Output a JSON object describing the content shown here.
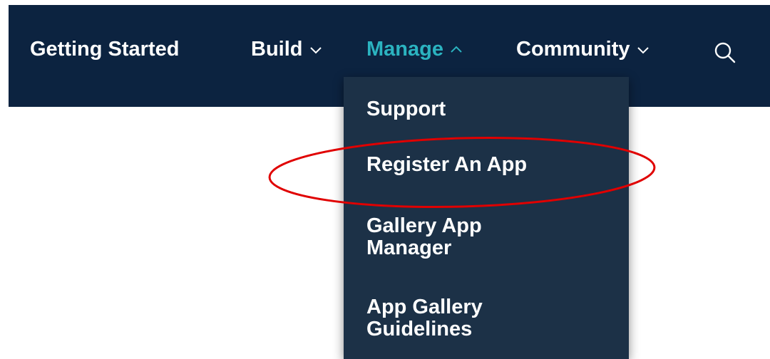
{
  "nav": {
    "items": [
      {
        "label": "Getting Started",
        "has_chevron": false,
        "active": false
      },
      {
        "label": "Build",
        "has_chevron": true,
        "active": false,
        "chevron": "chevron-down-icon"
      },
      {
        "label": "Manage",
        "has_chevron": true,
        "active": true,
        "chevron": "chevron-up-icon"
      },
      {
        "label": "Community",
        "has_chevron": true,
        "active": false,
        "chevron": "chevron-down-icon"
      }
    ],
    "search_icon": "search-icon"
  },
  "dropdown": {
    "items": [
      {
        "label": "Support"
      },
      {
        "label": "Register An App"
      },
      {
        "label": "Gallery App Manager"
      },
      {
        "label": "App Gallery Guidelines"
      }
    ]
  },
  "colors": {
    "navbar_bg": "#0c2340",
    "dropdown_bg": "#1c3147",
    "active_accent": "#2bb3c0",
    "annotation_red": "#e00000",
    "text": "#ffffff"
  }
}
